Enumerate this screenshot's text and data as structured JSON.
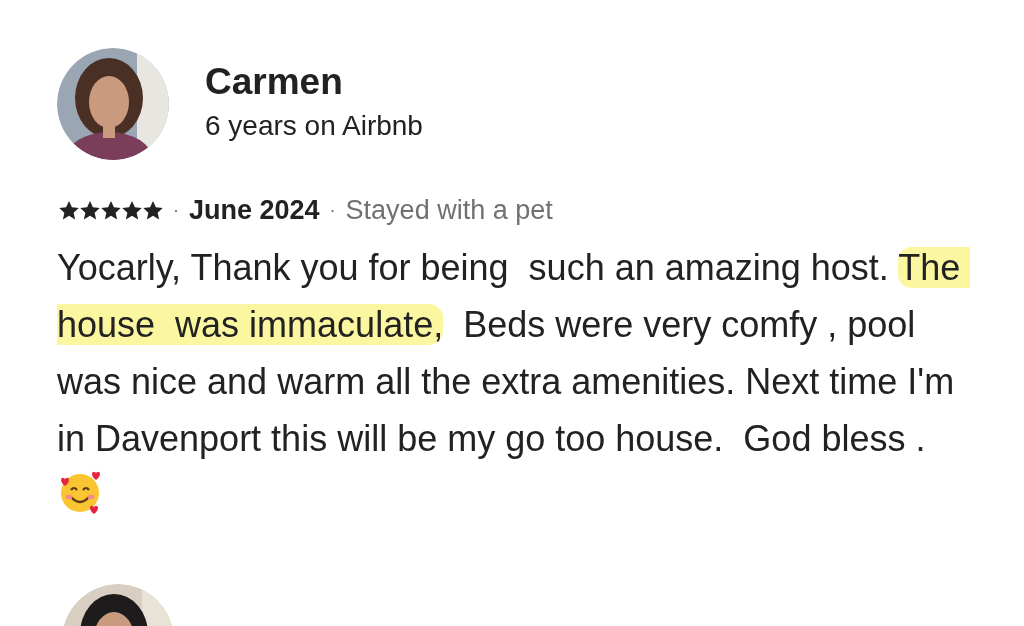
{
  "reviews": [
    {
      "name": "Carmen",
      "tenure": "6 years on Airbnb",
      "stars": 5,
      "separator": "·",
      "date": "June 2024",
      "stay_note": "Stayed with a pet",
      "body": [
        {
          "text": "Yocarly, Thank you for being  such an amazing host. ",
          "highlighted": false
        },
        {
          "text": "The house  was immaculate,",
          "highlighted": true
        },
        {
          "text": "  Beds were very comfy , pool was nice and warm all the extra amenities. Next time I'm in Davenport this will be my go too house.  God bless . ",
          "highlighted": false
        }
      ]
    },
    {
      "kind": "partial"
    }
  ]
}
